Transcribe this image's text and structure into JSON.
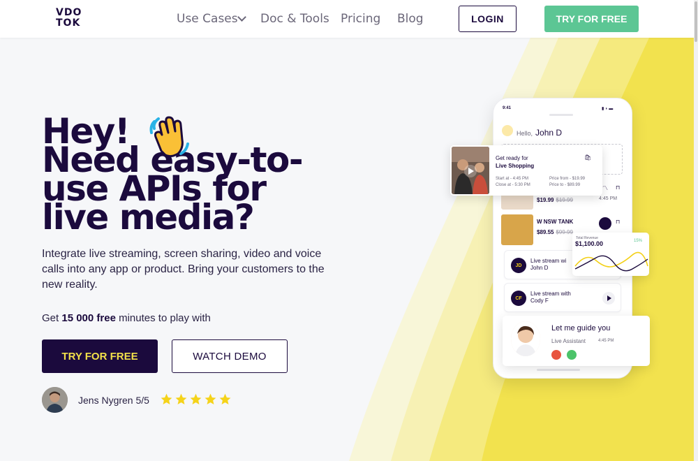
{
  "nav": {
    "logo_top": "VDO",
    "logo_bottom": "TOK",
    "links": [
      "Use Cases",
      "Doc & Tools",
      "Pricing",
      "Blog"
    ],
    "login_label": "LOGIN",
    "try_label": "TRY FOR FREE"
  },
  "hero": {
    "title_lines": [
      "Hey!",
      "Need easy-to-",
      "use APIs for",
      "live media?"
    ],
    "subtitle": "Integrate live streaming, screen sharing, video and voice calls into any app or product. Bring your customers to the new reality.",
    "free_prefix": "Get ",
    "free_bold": "15 000 free",
    "free_suffix": " minutes to play with",
    "try_label": "TRY FOR FREE",
    "demo_label": "WATCH DEMO",
    "reviewer": "Jens Nygren 5/5",
    "rating": 5
  },
  "phone": {
    "time": "9:41",
    "hello": "Hello,",
    "user": "John D",
    "shop": {
      "title_1": "Get ready for",
      "title_2": "Live Shopping",
      "start": "Start at - 4:45 PM",
      "close": "Close at - 5:30 PM",
      "price_from": "Price from - $19.99",
      "price_to": "Price to - $89.99"
    },
    "products": [
      {
        "name": "",
        "price": "$19.99",
        "old": "$19.99",
        "time": "4:45 PM"
      },
      {
        "name": "W NSW TANK",
        "price": "$89.55",
        "old": "$99.99"
      }
    ],
    "chart": {
      "label": "Total Revenue",
      "value": "$1,100.00",
      "pct": "15%"
    },
    "streams": [
      {
        "initials": "JD",
        "line1": "Live stream wi",
        "line2": "John D"
      },
      {
        "initials": "CF",
        "line1": "Live stream with",
        "line2": "Cody F"
      }
    ],
    "guide": {
      "title": "Let me guide you",
      "role": "Live Assistant",
      "time": "4:45 PM"
    }
  },
  "colors": {
    "brand": "#1b0a3d",
    "accent_green": "#5cc694",
    "accent_yellow": "#f3e14a"
  }
}
